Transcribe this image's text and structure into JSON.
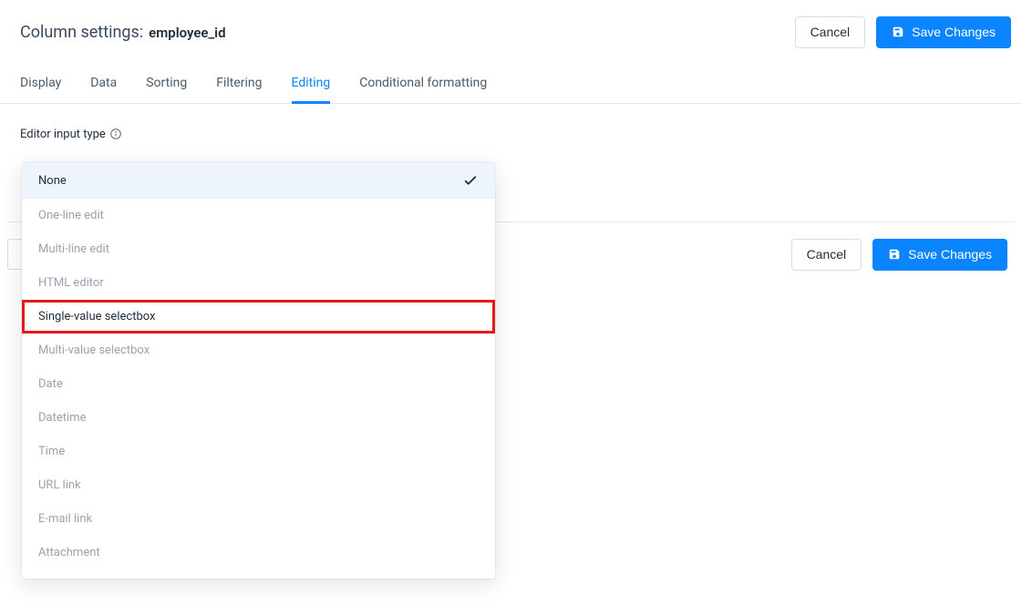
{
  "header": {
    "title_prefix": "Column settings:",
    "column_name": "employee_id",
    "cancel_label": "Cancel",
    "save_label": "Save Changes"
  },
  "tabs": [
    {
      "label": "Display",
      "active": false
    },
    {
      "label": "Data",
      "active": false
    },
    {
      "label": "Sorting",
      "active": false
    },
    {
      "label": "Filtering",
      "active": false
    },
    {
      "label": "Editing",
      "active": true
    },
    {
      "label": "Conditional formatting",
      "active": false
    }
  ],
  "field": {
    "label": "Editor input type"
  },
  "dropdown": {
    "selected": "None",
    "options": [
      {
        "label": "None",
        "highlighted": true,
        "selected": true,
        "emphasized": false
      },
      {
        "label": "One-line edit",
        "highlighted": false,
        "selected": false,
        "emphasized": false
      },
      {
        "label": "Multi-line edit",
        "highlighted": false,
        "selected": false,
        "emphasized": false
      },
      {
        "label": "HTML editor",
        "highlighted": false,
        "selected": false,
        "emphasized": false
      },
      {
        "label": "Single-value selectbox",
        "highlighted": false,
        "selected": false,
        "emphasized": true
      },
      {
        "label": "Multi-value selectbox",
        "highlighted": false,
        "selected": false,
        "emphasized": false
      },
      {
        "label": "Date",
        "highlighted": false,
        "selected": false,
        "emphasized": false
      },
      {
        "label": "Datetime",
        "highlighted": false,
        "selected": false,
        "emphasized": false
      },
      {
        "label": "Time",
        "highlighted": false,
        "selected": false,
        "emphasized": false
      },
      {
        "label": "URL link",
        "highlighted": false,
        "selected": false,
        "emphasized": false
      },
      {
        "label": "E-mail link",
        "highlighted": false,
        "selected": false,
        "emphasized": false
      },
      {
        "label": "Attachment",
        "highlighted": false,
        "selected": false,
        "emphasized": false
      }
    ]
  },
  "footer": {
    "cancel_label": "Cancel",
    "save_label": "Save Changes"
  }
}
